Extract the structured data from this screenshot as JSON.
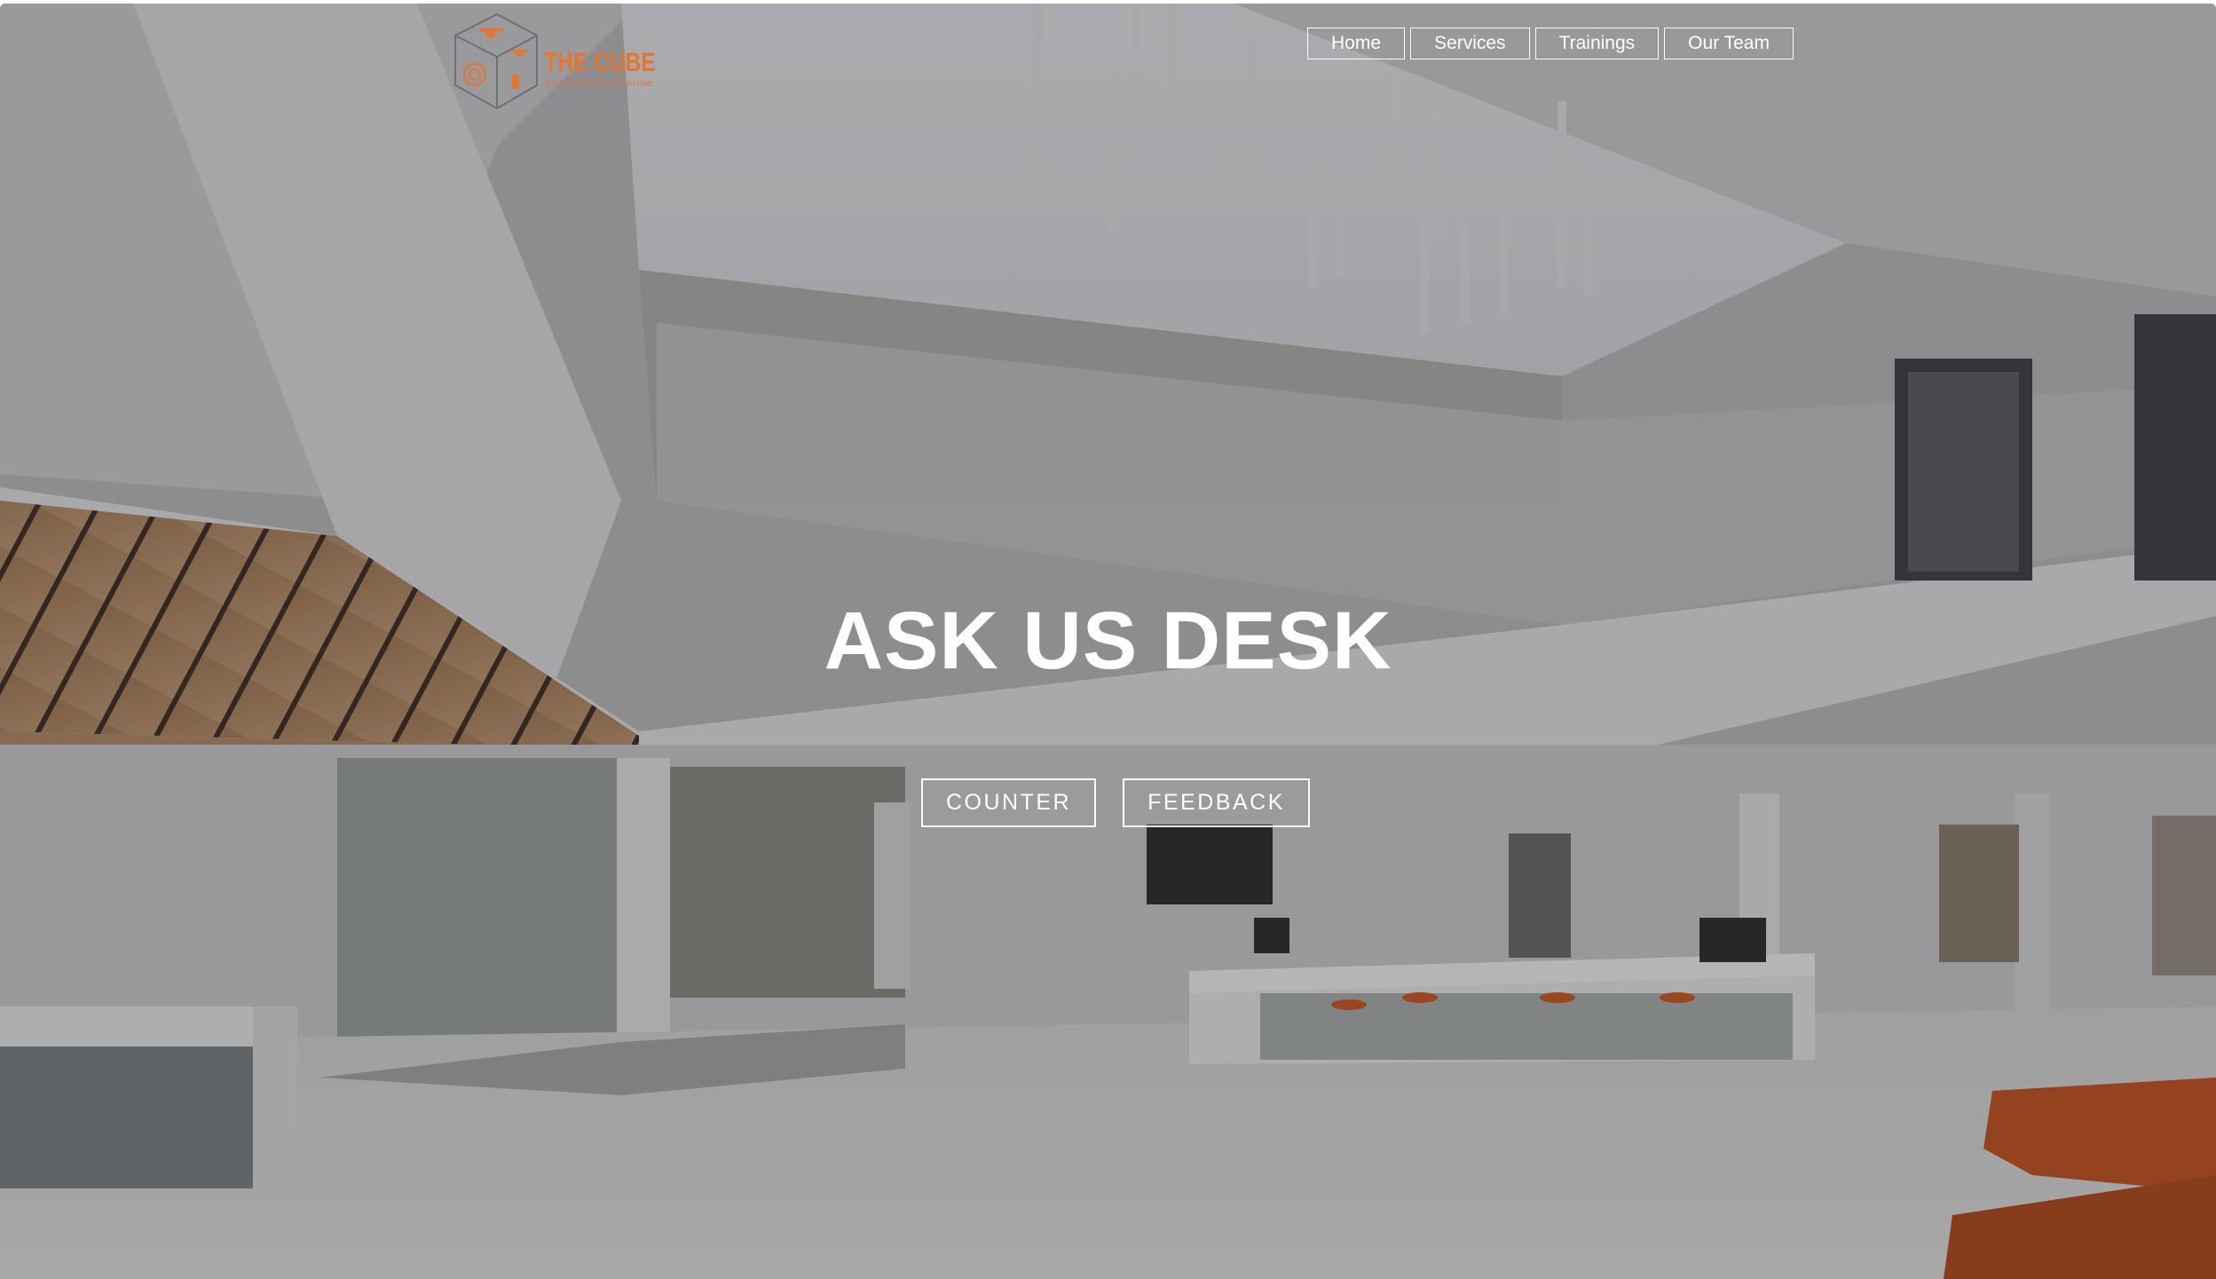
{
  "logo": {
    "title": "THE CUBE",
    "tagline": "INNOVATION FOR EVERYONE"
  },
  "nav": {
    "items": [
      {
        "label": "Home"
      },
      {
        "label": "Services"
      },
      {
        "label": "Trainings"
      },
      {
        "label": "Our Team"
      }
    ]
  },
  "hero": {
    "title": "ASK US DESK",
    "buttons": [
      {
        "label": "COUNTER"
      },
      {
        "label": "FEEDBACK"
      }
    ]
  },
  "colors": {
    "brand": "#e8732a",
    "overlay": "#1e1e22",
    "text": "#ffffff"
  }
}
